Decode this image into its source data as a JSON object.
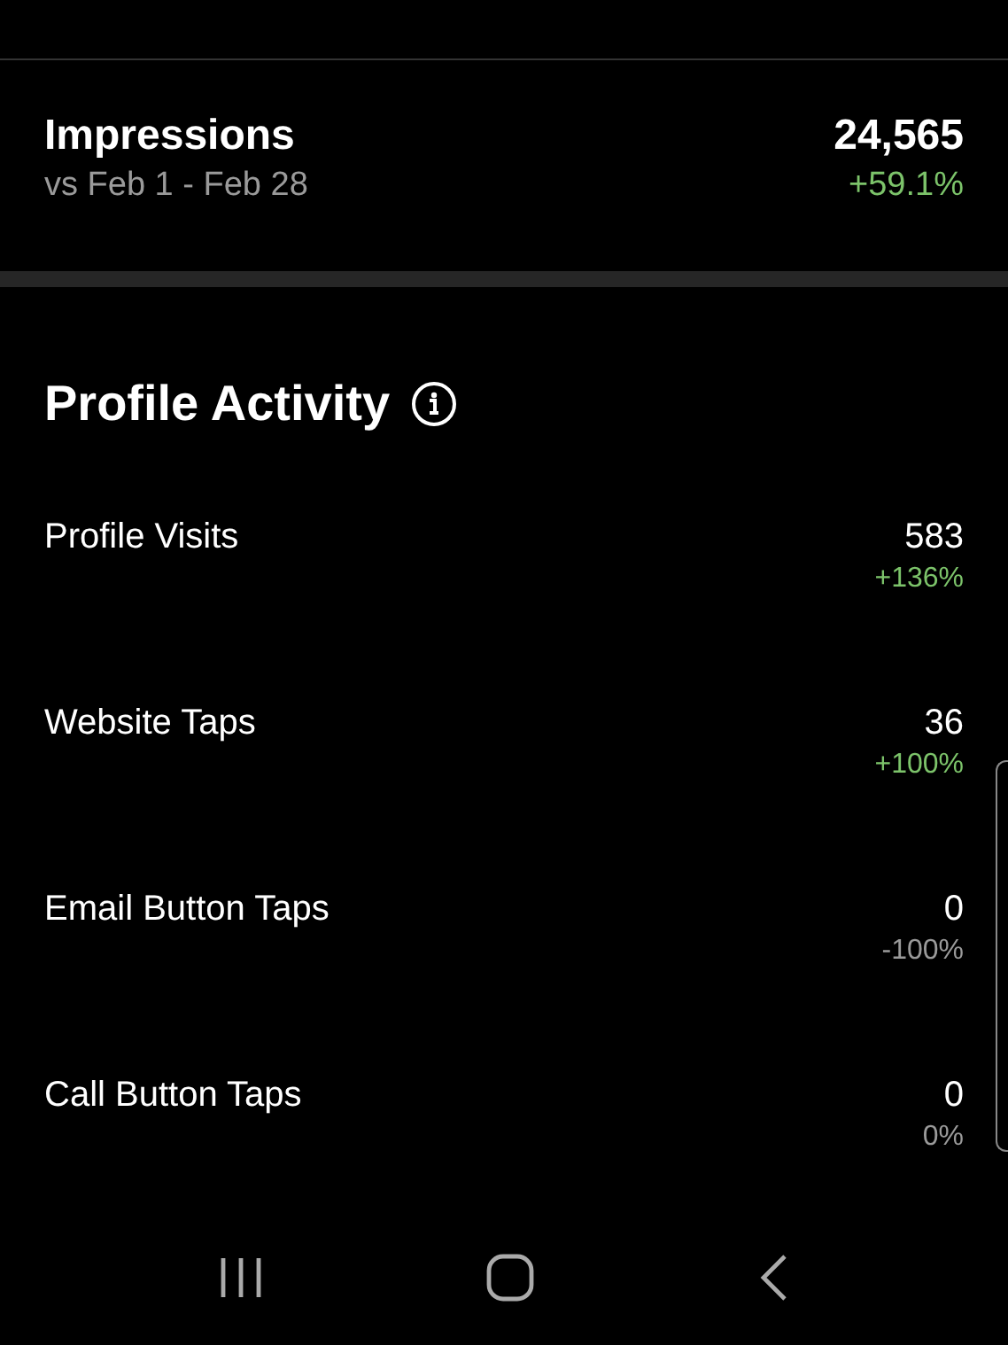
{
  "impressions": {
    "title": "Impressions",
    "subtitle": "vs Feb 1 - Feb 28",
    "value": "24,565",
    "change": "+59.1%",
    "color": "#7cc36a"
  },
  "profile_activity": {
    "title": "Profile Activity",
    "metrics": [
      {
        "label": "Profile Visits",
        "value": "583",
        "change": "+136%",
        "color": "#7cc36a"
      },
      {
        "label": "Website Taps",
        "value": "36",
        "change": "+100%",
        "color": "#7cc36a"
      },
      {
        "label": "Email Button Taps",
        "value": "0",
        "change": "-100%",
        "color": "#9a9a9a"
      },
      {
        "label": "Call Button Taps",
        "value": "0",
        "change": "0%",
        "color": "#9a9a9a"
      }
    ]
  }
}
